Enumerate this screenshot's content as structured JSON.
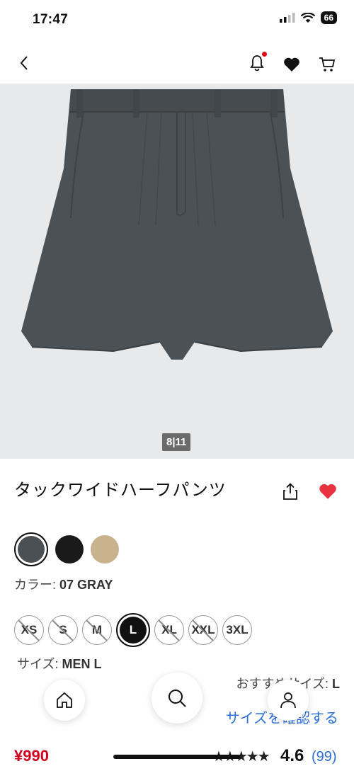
{
  "status": {
    "time": "17:47",
    "battery": "66"
  },
  "nav": {
    "back": "back-icon",
    "bell": "bell-icon",
    "heart": "heart-icon",
    "cart": "cart-icon"
  },
  "gallery": {
    "counter_current": "8",
    "counter_total": "11"
  },
  "product": {
    "title": "タックワイドハーフパンツ",
    "color_label": "カラー:",
    "color_value": "07 GRAY",
    "colors": [
      "#4a5054",
      "#1a1a1a",
      "#c8b18d"
    ],
    "size_label": "サイズ:",
    "size_value": "MEN L",
    "sizes": [
      {
        "label": "XS",
        "available": false
      },
      {
        "label": "S",
        "available": false
      },
      {
        "label": "M",
        "available": false
      },
      {
        "label": "L",
        "available": true,
        "selected": true
      },
      {
        "label": "XL",
        "available": false
      },
      {
        "label": "XXL",
        "available": false
      },
      {
        "label": "3XL",
        "available": true
      }
    ],
    "recommend_label": "おすすめサイズ:",
    "recommend_value": "L",
    "check_size": "サイズを確認する",
    "price": "¥990",
    "rating": "4.6",
    "reviews": "(99)"
  },
  "colors": {
    "accent_red": "#e60012",
    "link_blue": "#2e6fd8"
  }
}
